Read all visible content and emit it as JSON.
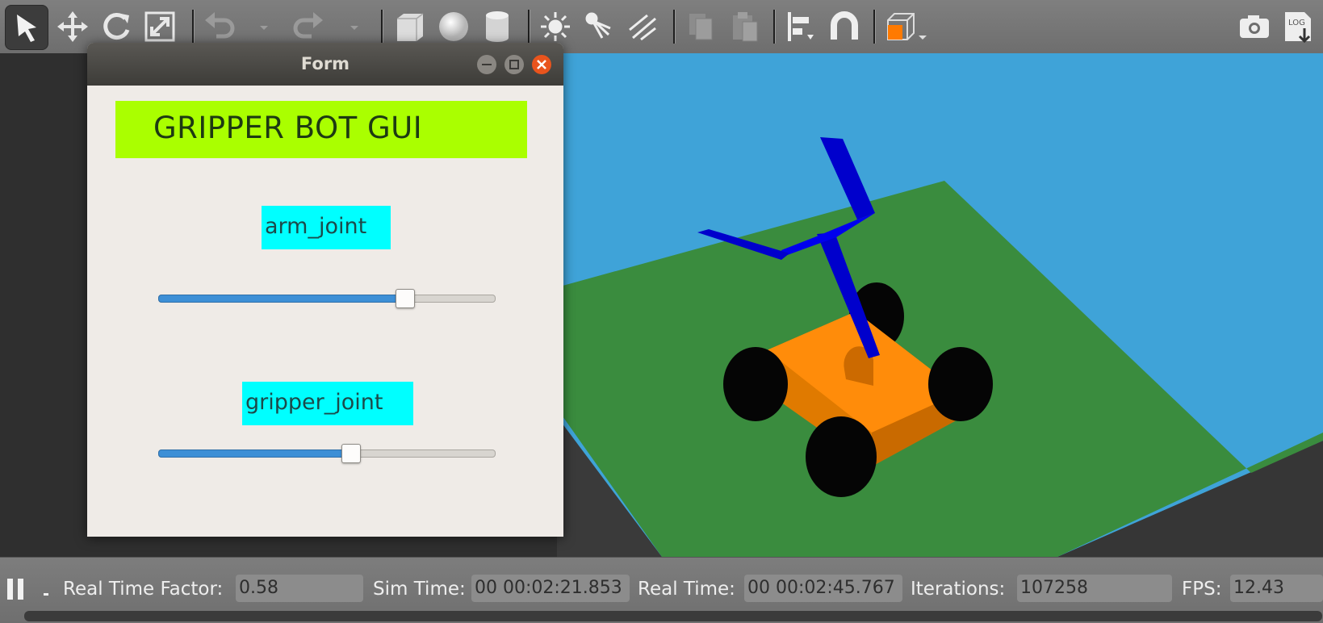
{
  "toolbar": {
    "icons": [
      "select-arrow-icon",
      "translate-icon",
      "rotate-icon",
      "scale-icon",
      "undo-icon",
      "redo-icon",
      "box-icon",
      "sphere-icon",
      "cylinder-icon",
      "point-light-icon",
      "spot-light-icon",
      "directional-light-icon",
      "copy-icon",
      "paste-icon",
      "align-icon",
      "magnet-icon",
      "view-angle-icon",
      "screenshot-icon",
      "log-icon"
    ],
    "log_text": "LOG"
  },
  "form": {
    "window_title": "Form",
    "gui_title": "GRIPPER BOT GUI",
    "arm_label": "arm_joint",
    "gripper_label": "gripper_joint",
    "arm_slider_fraction": 0.73,
    "gripper_slider_fraction": 0.57
  },
  "status": {
    "rtf_label": "Real Time Factor:",
    "rtf_value": "0.58",
    "sim_time_label": "Sim Time:",
    "sim_time_value": "00 00:02:21.853",
    "real_time_label": "Real Time:",
    "real_time_value": "00 00:02:45.767",
    "iterations_label": "Iterations:",
    "iterations_value": "107258",
    "fps_label": "FPS:",
    "fps_value": "12.43"
  },
  "colors": {
    "sky": "#3fa3d8",
    "ground": "#3a8c3e",
    "chassis": "#ff8c0a",
    "arm": "#0000cc",
    "title_bg": "#aaff00",
    "label_bg": "#00ffff",
    "slider_fill": "#3d8fd6"
  }
}
